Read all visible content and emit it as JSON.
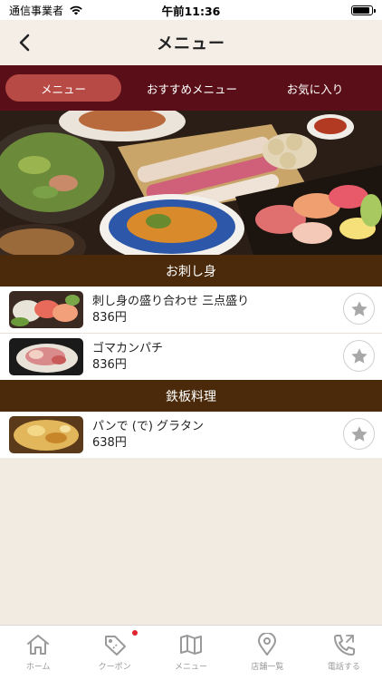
{
  "status_bar": {
    "carrier": "通信事業者",
    "time": "午前11:36"
  },
  "header": {
    "title": "メニュー"
  },
  "tabs": [
    {
      "label": "メニュー",
      "active": true
    },
    {
      "label": "おすすめメニュー",
      "active": false
    },
    {
      "label": "お気に入り",
      "active": false
    }
  ],
  "sections": [
    {
      "title": "お刺し身",
      "items": [
        {
          "name": "刺し身の盛り合わせ 三点盛り",
          "price": "836円"
        },
        {
          "name": "ゴマカンパチ",
          "price": "836円"
        }
      ]
    },
    {
      "title": "鉄板料理",
      "items": [
        {
          "name": "パンで (で) グラタン",
          "price": "638円"
        }
      ]
    }
  ],
  "tab_bar": [
    {
      "label": "ホーム",
      "icon": "home-icon"
    },
    {
      "label": "クーポン",
      "icon": "coupon-tag-icon",
      "badge": true
    },
    {
      "label": "メニュー",
      "icon": "map-menu-icon"
    },
    {
      "label": "店舗一覧",
      "icon": "location-pin-icon"
    },
    {
      "label": "電話する",
      "icon": "phone-icon"
    }
  ],
  "colors": {
    "tab_bar_bg": "#5a0f18",
    "tab_active": "#b84a45",
    "section_header": "#4a2a0a",
    "background": "#f1ebe2"
  }
}
